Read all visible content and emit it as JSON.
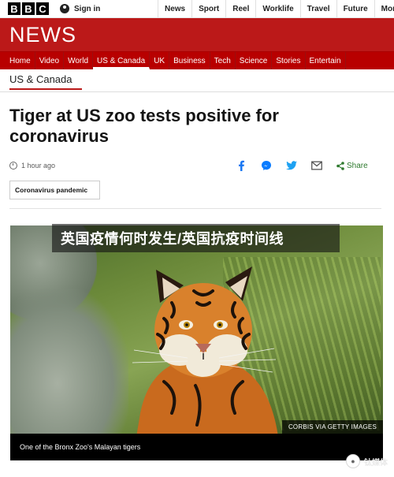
{
  "header": {
    "logo_letters": [
      "B",
      "B",
      "C"
    ],
    "signin_label": "Sign in",
    "top_nav": [
      "News",
      "Sport",
      "Reel",
      "Worklife",
      "Travel",
      "Future",
      "Mor"
    ]
  },
  "news_banner": {
    "title": "NEWS",
    "brand_color": "#bb1919"
  },
  "section_nav": {
    "items": [
      "Home",
      "Video",
      "World",
      "US & Canada",
      "UK",
      "Business",
      "Tech",
      "Science",
      "Stories",
      "Entertain"
    ],
    "active": "US & Canada"
  },
  "section_label": "US & Canada",
  "article": {
    "headline": "Tiger at US zoo tests positive for coronavirus",
    "time": "1 hour ago",
    "share_label": "Share",
    "tag": "Coronavirus pandemic",
    "image_credit": "CORBIS VIA GETTY IMAGES",
    "caption": "One of the Bronx Zoo's Malayan tigers"
  },
  "overlay_banner": "英国疫情何时发生/英国抗疫时间线",
  "watermark": "钛媒体"
}
